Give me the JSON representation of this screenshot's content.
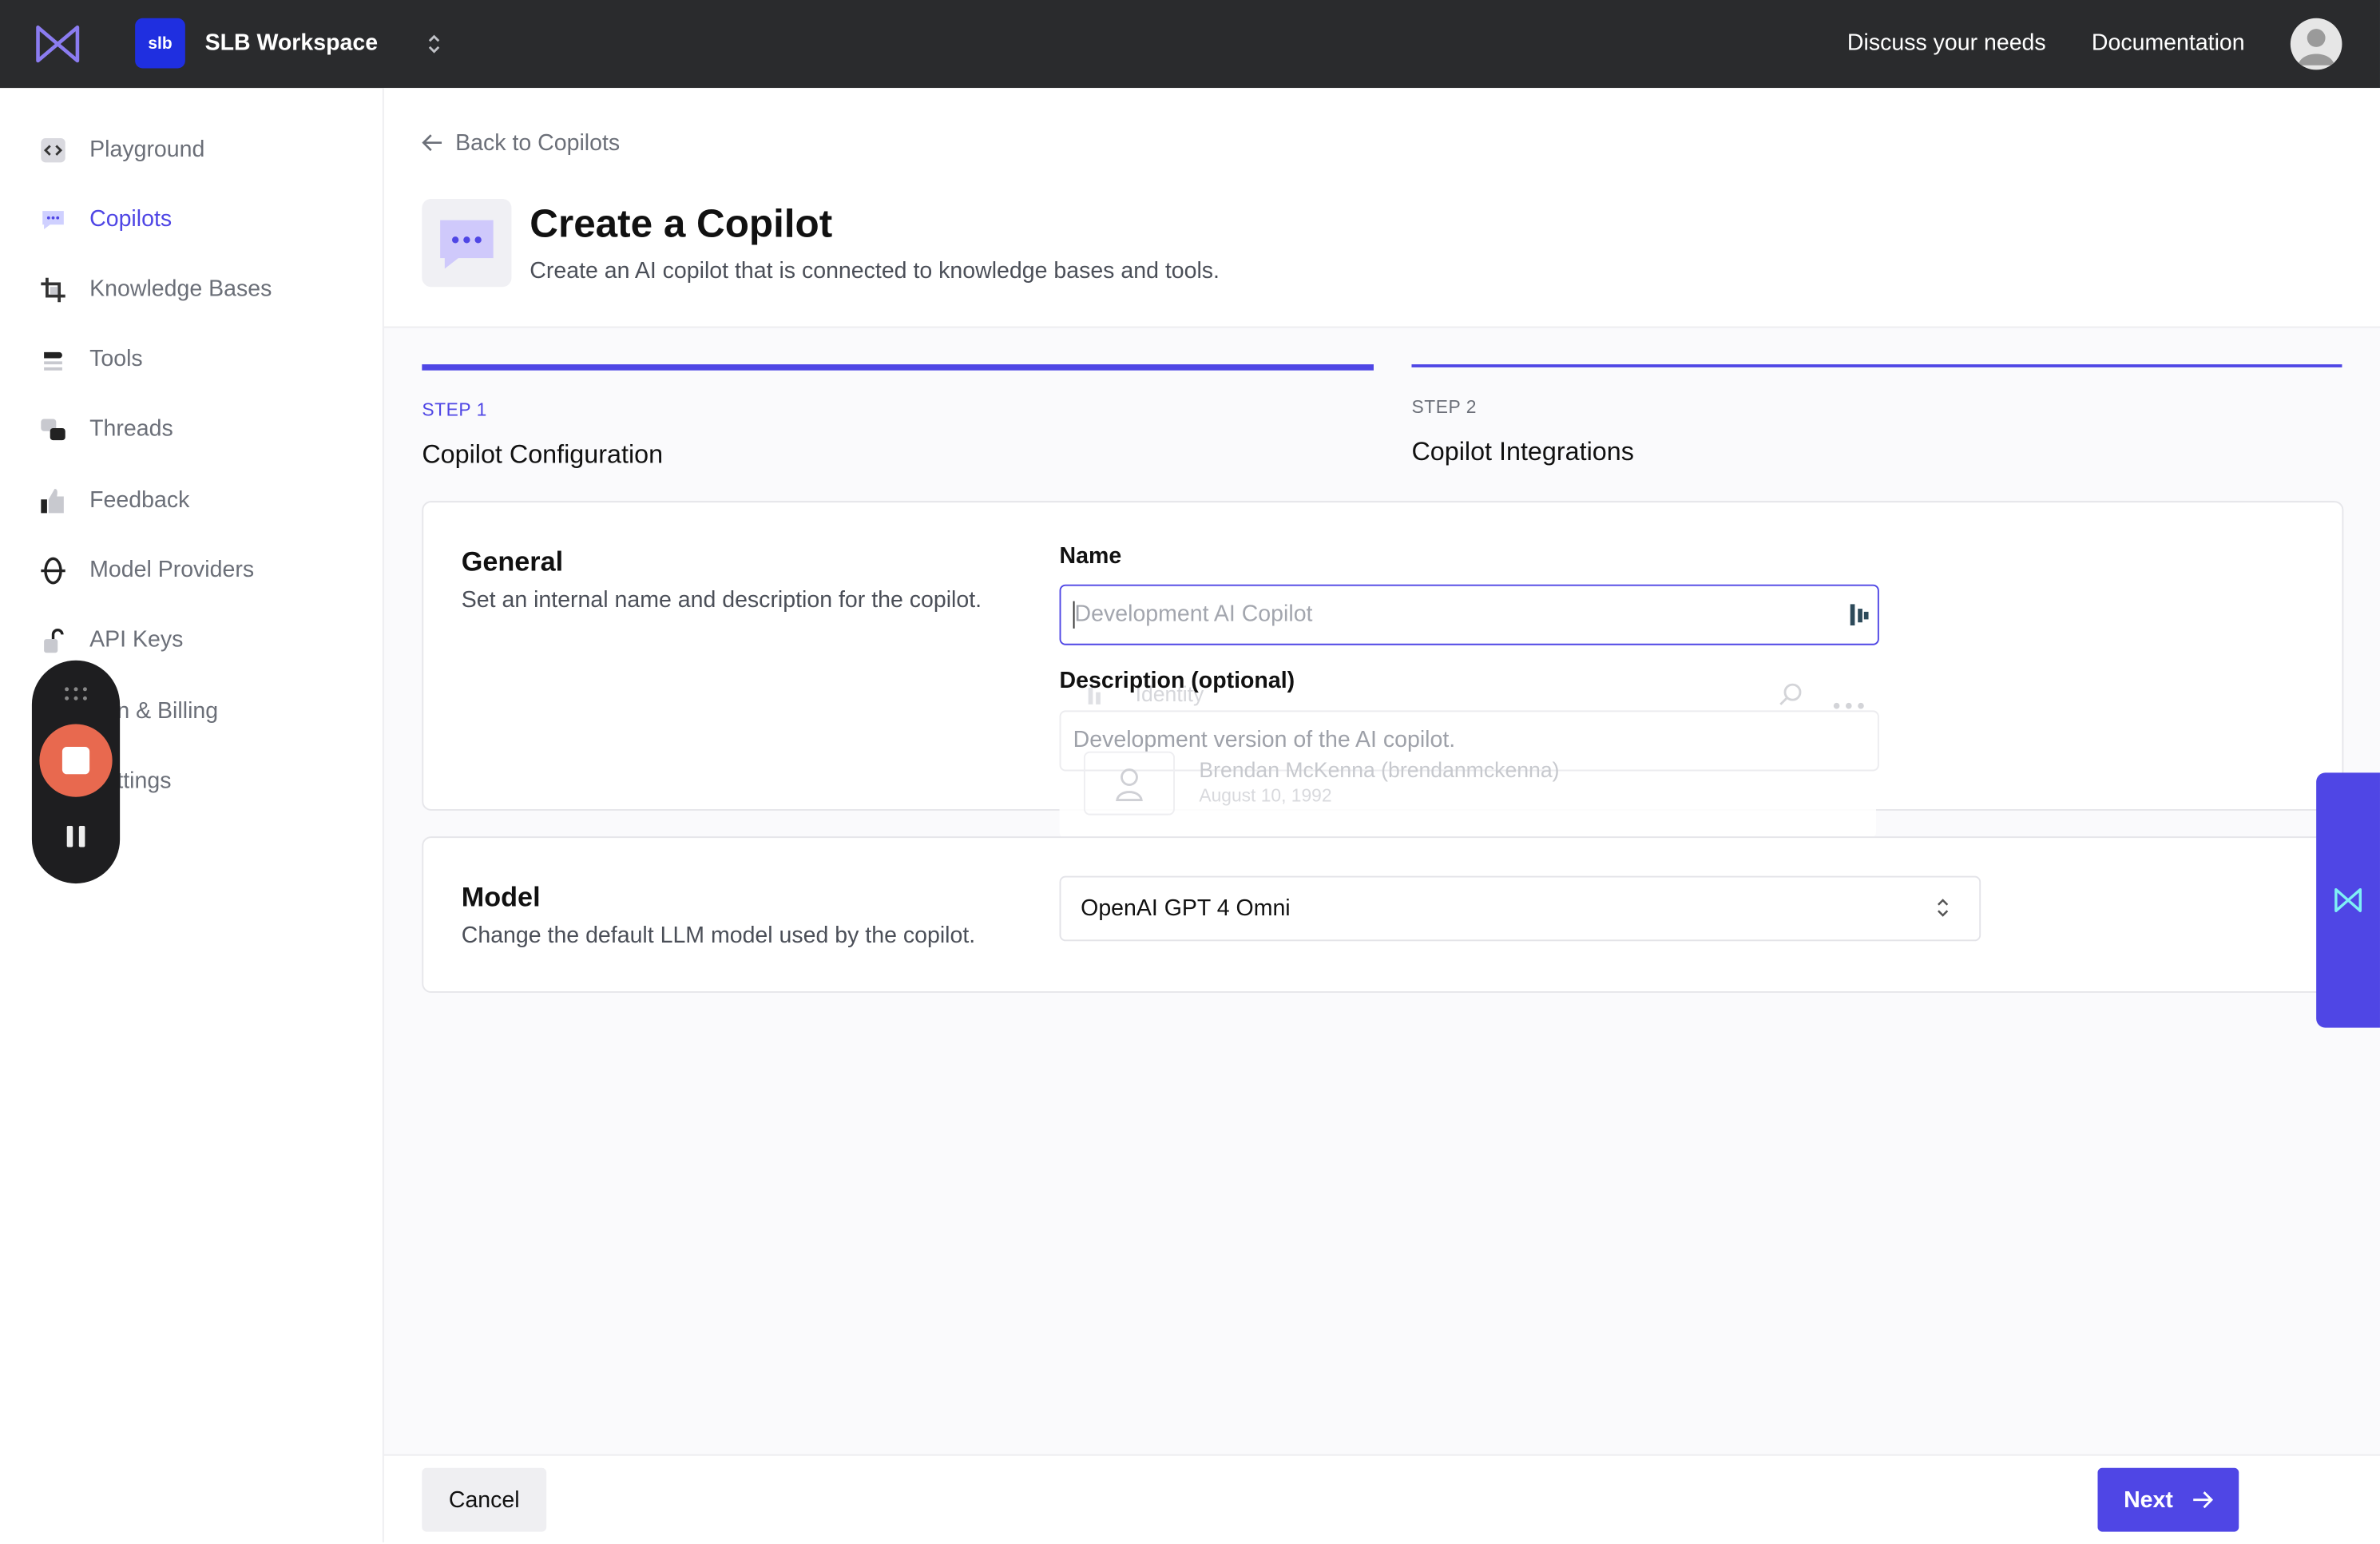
{
  "header": {
    "workspace_badge": "slb",
    "workspace_name": "SLB Workspace",
    "links": [
      "Discuss your needs",
      "Documentation"
    ]
  },
  "sidebar": {
    "items": [
      {
        "label": "Playground",
        "icon": "code-icon"
      },
      {
        "label": "Copilots",
        "icon": "chat-icon",
        "active": true
      },
      {
        "label": "Knowledge Bases",
        "icon": "crop-icon"
      },
      {
        "label": "Tools",
        "icon": "tools-icon"
      },
      {
        "label": "Threads",
        "icon": "threads-icon"
      },
      {
        "label": "Feedback",
        "icon": "thumbs-up-icon"
      },
      {
        "label": "Model Providers",
        "icon": "globe-icon"
      },
      {
        "label": "API Keys",
        "icon": "unlock-icon"
      },
      {
        "label": "n & Billing",
        "icon": ""
      },
      {
        "label": "ttings",
        "icon": ""
      }
    ]
  },
  "page": {
    "back_label": "Back to Copilots",
    "title": "Create a Copilot",
    "subtitle": "Create an AI copilot that is connected to knowledge bases and tools."
  },
  "steps": [
    {
      "number": "STEP 1",
      "title": "Copilot Configuration",
      "active": true
    },
    {
      "number": "STEP 2",
      "title": "Copilot Integrations",
      "active": false
    }
  ],
  "general": {
    "title": "General",
    "subtitle": "Set an internal name and description for the copilot.",
    "name_label": "Name",
    "name_placeholder": "Development AI Copilot",
    "description_label": "Description (optional)",
    "description_placeholder": "Development version of the AI copilot."
  },
  "overlay": {
    "identity_label": "Identity",
    "person": "Brendan McKenna (brendanmckenna)",
    "date": "August 10, 1992"
  },
  "model": {
    "title": "Model",
    "subtitle": "Change the default LLM model used by the copilot.",
    "selected": "OpenAI GPT 4 Omni"
  },
  "footer": {
    "cancel_label": "Cancel",
    "next_label": "Next"
  },
  "colors": {
    "accent": "#4f46e5",
    "topbar": "#2a2b2d",
    "record": "#e8694f"
  }
}
